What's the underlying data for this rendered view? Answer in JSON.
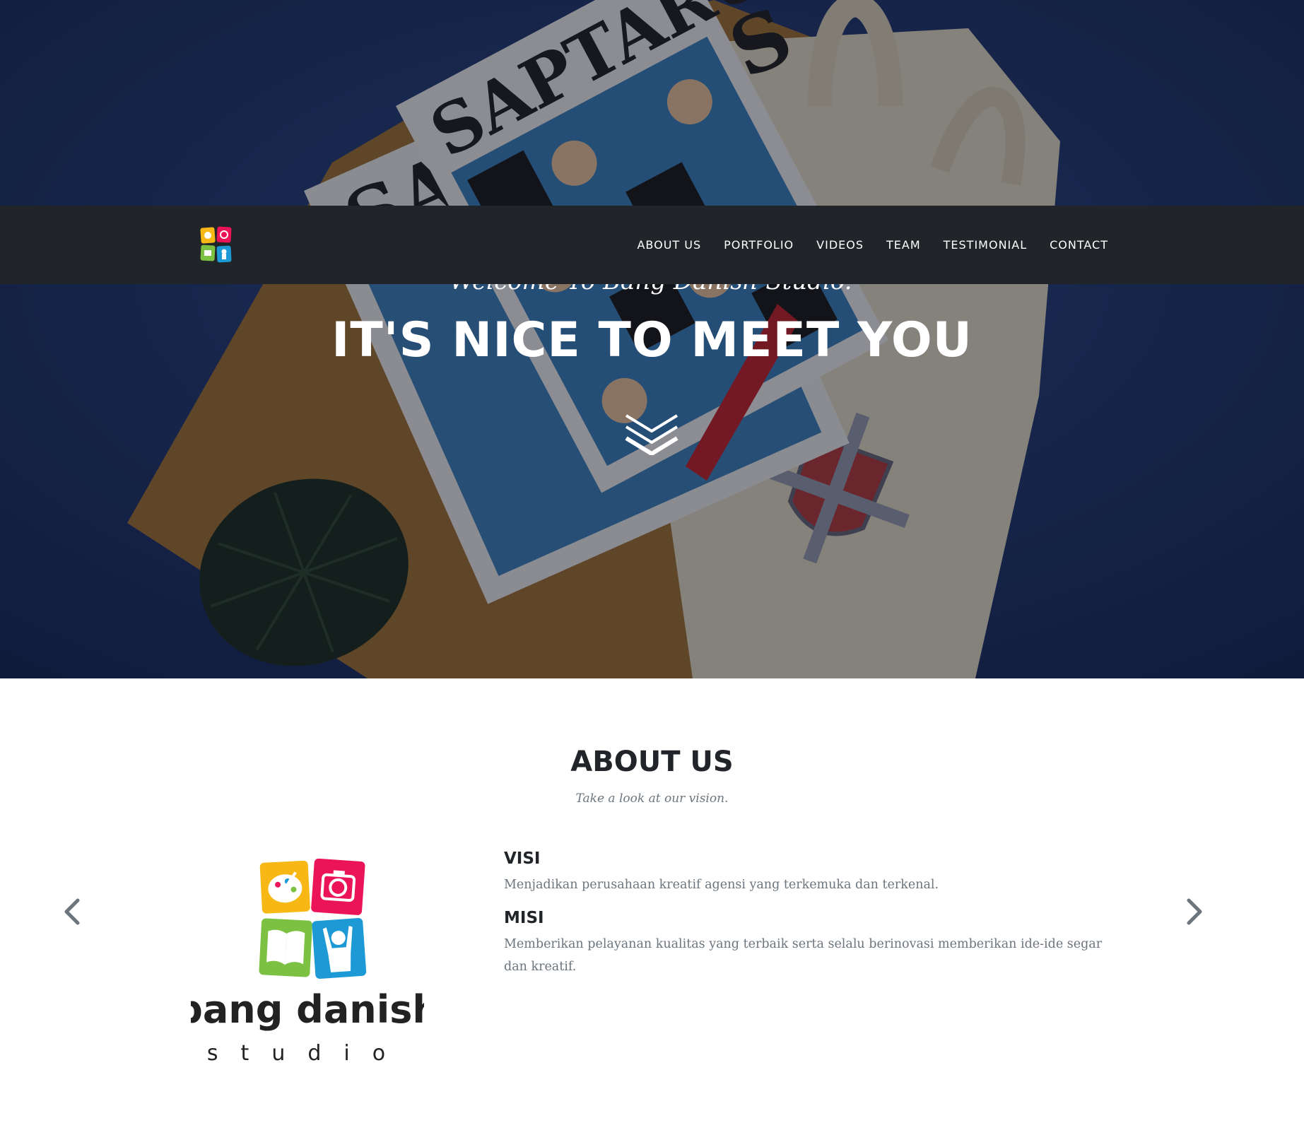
{
  "colors": {
    "navbar_bg": "#212529",
    "hero_blue": "#203a72",
    "heading": "#212529",
    "muted_text": "#6c757d",
    "logo_yellow": "#f7b816",
    "logo_pink": "#ec1459",
    "logo_green": "#7cc142",
    "logo_blue": "#1d9ad6"
  },
  "navbar": {
    "logo_icon": "bang-danish-studio-logo-icon",
    "links": [
      "ABOUT US",
      "PORTFOLIO",
      "VIDEOS",
      "TEAM",
      "TESTIMONIAL",
      "CONTACT"
    ]
  },
  "hero": {
    "welcome": "Welcome To Bang Danish Studio!",
    "title": "IT'S NICE TO MEET YOU",
    "scroll_icon": "double-chevron-down-icon"
  },
  "about": {
    "title": "ABOUT US",
    "subtitle": "Take a look at our vision.",
    "prev_icon": "chevron-left-icon",
    "next_icon": "chevron-right-icon",
    "logo": {
      "word1": "bang danish",
      "word2": "studio"
    },
    "visi": {
      "heading": "VISI",
      "text": "Menjadikan perusahaan kreatif agensi yang terkemuka dan terkenal."
    },
    "misi": {
      "heading": "MISI",
      "text": "Memberikan pelayanan kualitas yang terbaik serta selalu berinovasi memberikan ide-ide segar dan kreatif."
    }
  }
}
